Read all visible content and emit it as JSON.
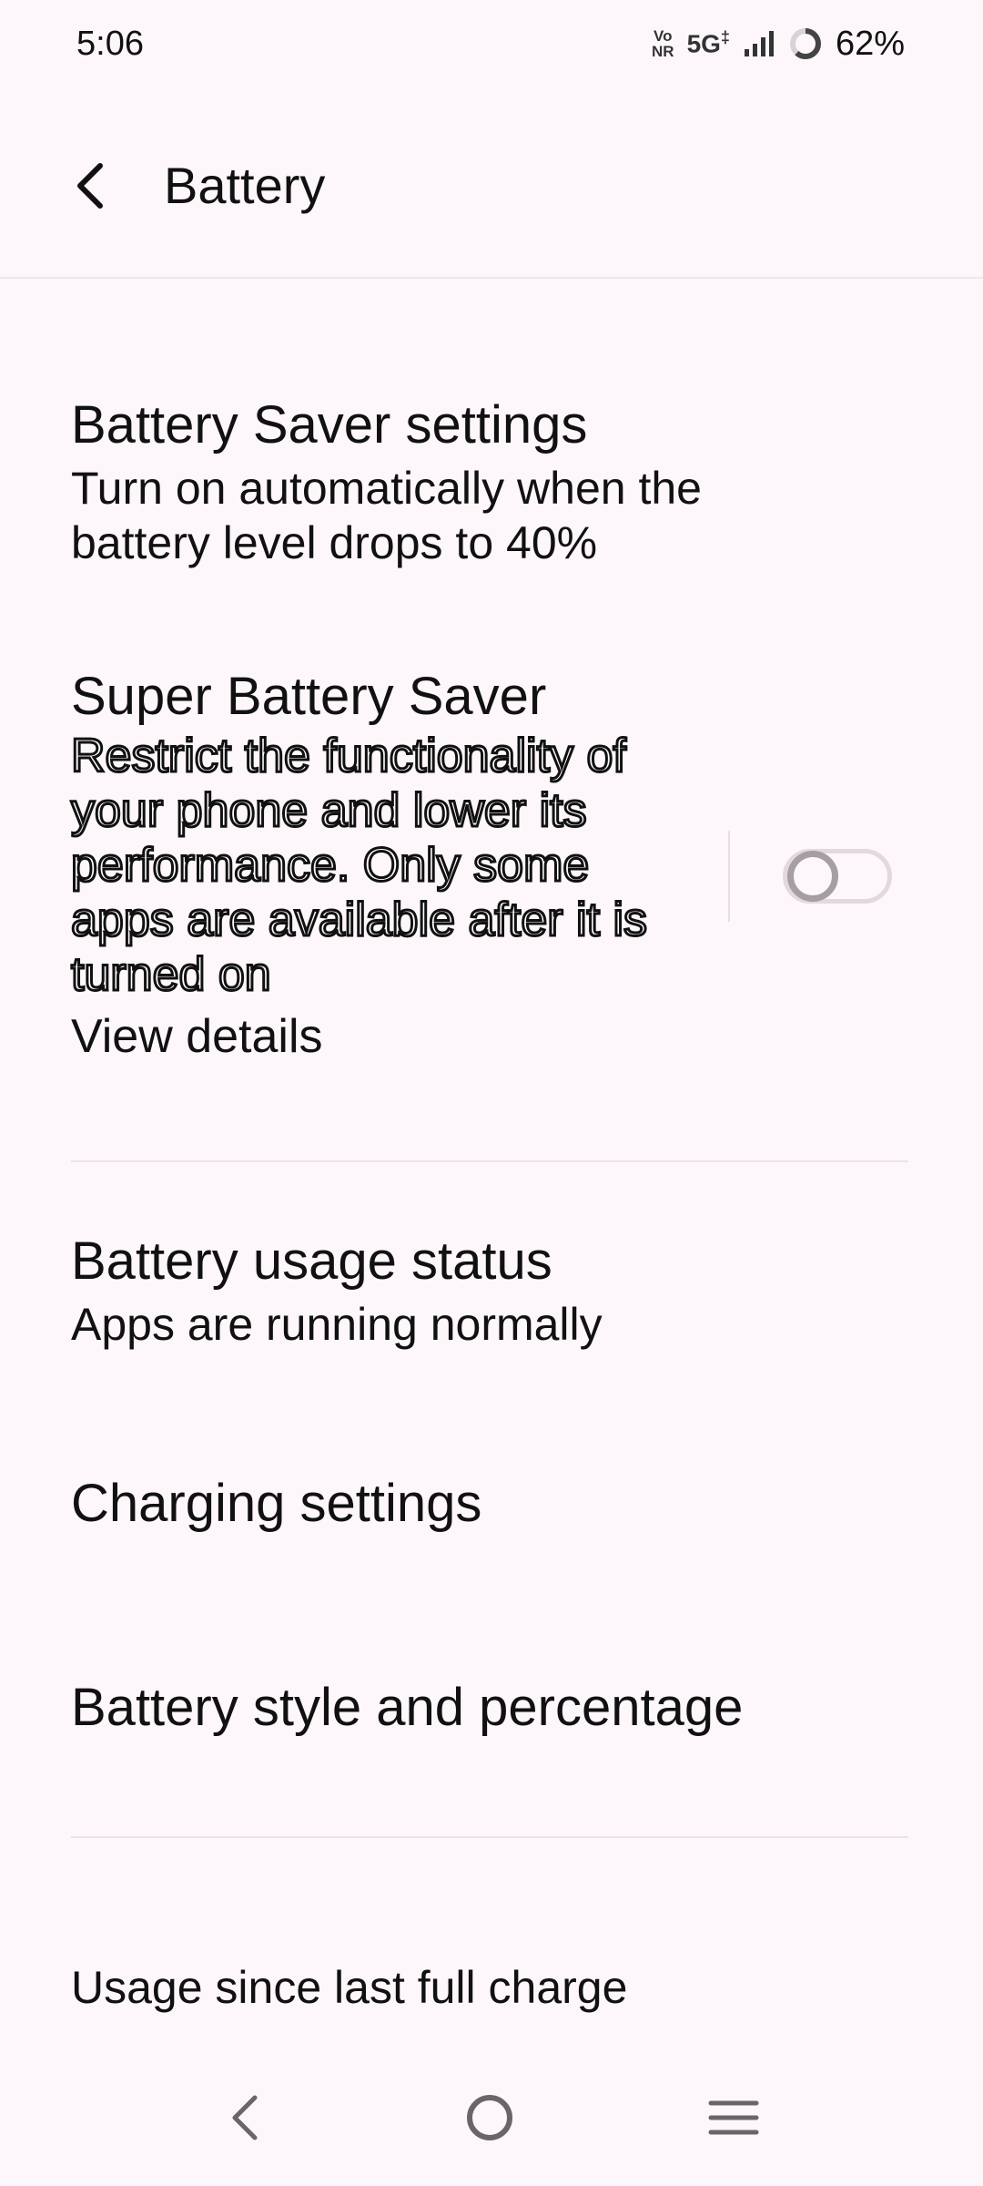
{
  "status_bar": {
    "time": "5:06",
    "volte_top": "Vo",
    "volte_bottom": "NR",
    "network": "5G",
    "network_sup": "‡",
    "battery_percent": "62%"
  },
  "header": {
    "title": "Battery"
  },
  "settings": {
    "battery_saver": {
      "title": "Battery Saver settings",
      "subtitle": "Turn on automatically when the battery level drops to 40%"
    },
    "super_saver": {
      "title": "Super Battery Saver",
      "description": "Restrict the functionality of your phone and lower its performance. Only some apps are available after it is turned on",
      "link": "View details",
      "enabled": false
    },
    "usage_status": {
      "title": "Battery usage status",
      "subtitle": "Apps are running normally"
    },
    "charging": {
      "title": "Charging settings"
    },
    "style": {
      "title": "Battery style and percentage"
    },
    "usage_since": {
      "title": "Usage since last full charge"
    }
  },
  "colors": {
    "background": "#fdf7fb",
    "text": "#111111",
    "toggle_off": "#a59ea4"
  },
  "icons": {
    "back": "chevron-left-icon",
    "signal": "signal-bars-icon",
    "battery": "battery-ring-icon",
    "nav_back": "nav-back-icon",
    "nav_home": "nav-home-icon",
    "nav_menu": "nav-menu-icon"
  }
}
